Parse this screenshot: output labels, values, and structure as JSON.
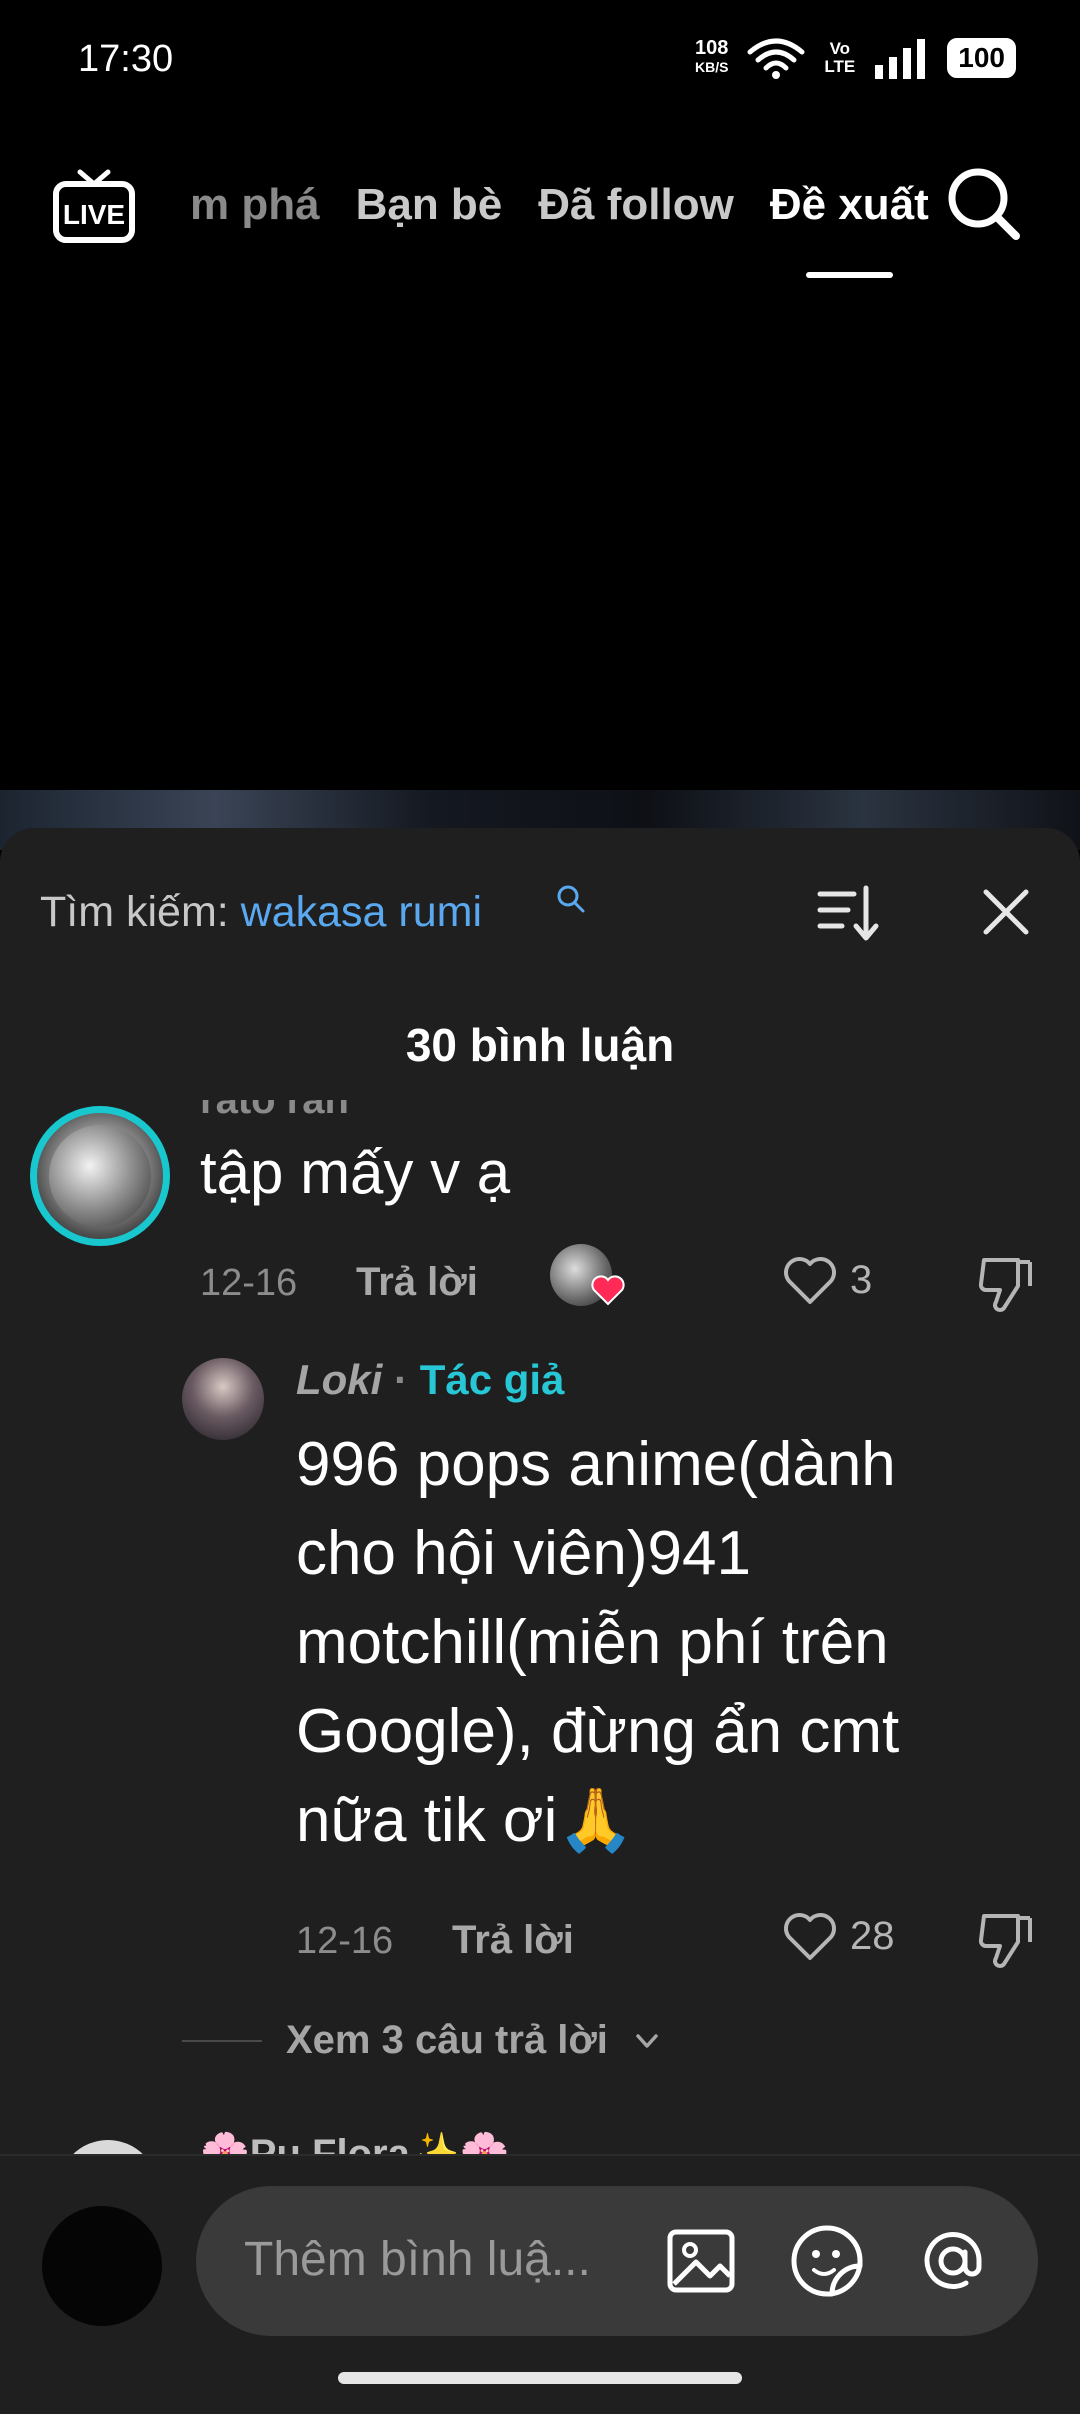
{
  "status_bar": {
    "time": "17:30",
    "net_speed_value": "108",
    "net_speed_unit": "KB/S",
    "volte_top": "Vo",
    "volte_bottom": "LTE",
    "battery": "100"
  },
  "top_nav": {
    "live_label": "LIVE",
    "tabs": [
      {
        "label": "m phá",
        "state": "faded"
      },
      {
        "label": "Bạn bè",
        "state": "normal"
      },
      {
        "label": "Đã follow",
        "state": "normal"
      },
      {
        "label": "Đề xuất",
        "state": "active"
      }
    ]
  },
  "comments_sheet": {
    "search_prefix": "Tìm kiếm:",
    "search_term": "wakasa rumi",
    "count_label": "30 bình luận",
    "comments": [
      {
        "author_partial": "rato ran",
        "text": "tập mấy v ạ",
        "date": "12-16",
        "reply_label": "Trả lời",
        "likes": "3"
      },
      {
        "author": "Loki",
        "author_separator": "·",
        "author_tag": "Tác giả",
        "text": "996 pops anime(dành cho hội viên)941 motchill(miễn phí trên Google), đừng ẩn cmt nữa tik ơi🙏",
        "date": "12-16",
        "reply_label": "Trả lời",
        "likes": "28"
      }
    ],
    "view_replies_label": "Xem 3 câu trả lời",
    "next_author_partial": "🌸Pu Flora✨🌸"
  },
  "input_bar": {
    "placeholder": "Thêm bình luậ..."
  },
  "colors": {
    "accent_search_term": "#5aa9f0",
    "author_tag": "#27c7d6",
    "avatar_ring": "#19c7cf",
    "sticker_heart": "#ff2a55"
  }
}
